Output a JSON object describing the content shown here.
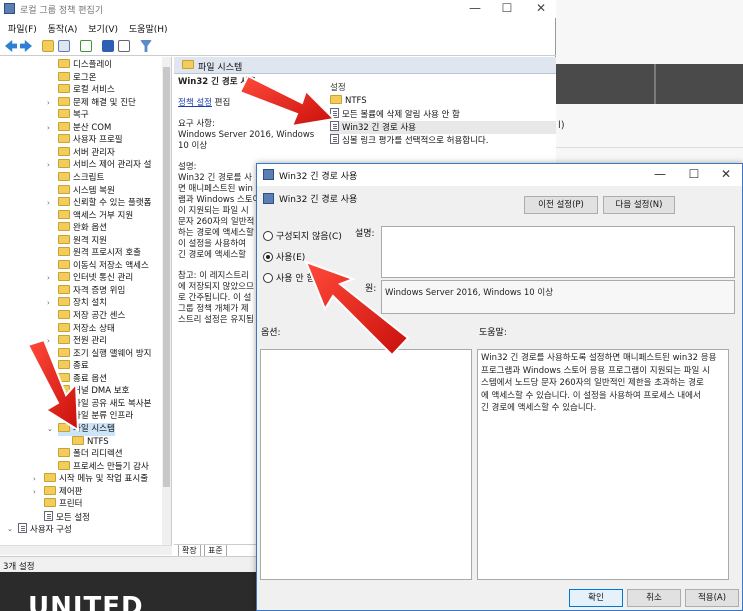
{
  "main_window": {
    "title": "로컬 그룹 정책 편집기",
    "controls": {
      "minimize": "—",
      "maximize": "☐",
      "close": "✕"
    },
    "menu": [
      "파일(F)",
      "동작(A)",
      "보기(V)",
      "도움말(H)"
    ],
    "toolbar_icons": [
      "back-icon",
      "forward-icon",
      "folder-up-icon",
      "show-hide-tree-icon",
      "export-icon",
      "help-icon",
      "properties-icon",
      "filter-icon"
    ]
  },
  "tree": {
    "items": [
      {
        "label": "디스플레이",
        "expand": ""
      },
      {
        "label": "로그온",
        "expand": ""
      },
      {
        "label": "로컬 서비스",
        "expand": ""
      },
      {
        "label": "문제 해결 및 진단",
        "expand": "›"
      },
      {
        "label": "복구",
        "expand": ""
      },
      {
        "label": "분산 COM",
        "expand": "›"
      },
      {
        "label": "사용자 프로필",
        "expand": ""
      },
      {
        "label": "서버 관리자",
        "expand": ""
      },
      {
        "label": "서비스 제어 관리자 설",
        "expand": "›"
      },
      {
        "label": "스크립트",
        "expand": ""
      },
      {
        "label": "시스템 복원",
        "expand": ""
      },
      {
        "label": "신뢰할 수 있는 플랫폼",
        "expand": "›"
      },
      {
        "label": "액세스 거부 지원",
        "expand": ""
      },
      {
        "label": "완화 옵션",
        "expand": ""
      },
      {
        "label": "원격 지원",
        "expand": ""
      },
      {
        "label": "원격 프로시저 호출",
        "expand": ""
      },
      {
        "label": "이동식 저장소 액세스",
        "expand": ""
      },
      {
        "label": "인터넷 통신 관리",
        "expand": "›"
      },
      {
        "label": "자격 증명 위임",
        "expand": ""
      },
      {
        "label": "장치 설치",
        "expand": "›"
      },
      {
        "label": "저장 공간 센스",
        "expand": ""
      },
      {
        "label": "저장소 상태",
        "expand": ""
      },
      {
        "label": "전원 관리",
        "expand": "›"
      },
      {
        "label": "조기 실행 맬웨어 방지",
        "expand": ""
      },
      {
        "label": "종료",
        "expand": ""
      },
      {
        "label": "종료 옵션",
        "expand": ""
      },
      {
        "label": "커널 DMA 보호",
        "expand": ""
      },
      {
        "label": "파일 공유 새도 복사본",
        "expand": ""
      },
      {
        "label": "파일 분류 인프라",
        "expand": ""
      },
      {
        "label": "파일 시스템",
        "expand": "⌄"
      },
      {
        "label": "NTFS",
        "expand": ""
      },
      {
        "label": "폴더 리디렉션",
        "expand": ""
      },
      {
        "label": "프로세스 만들기 감사",
        "expand": ""
      },
      {
        "label": "시작 메뉴 및 작업 표시줄",
        "expand": "›"
      },
      {
        "label": "제어판",
        "expand": "›"
      },
      {
        "label": "프린터",
        "expand": ""
      },
      {
        "label": "모든 설정",
        "expand": ""
      },
      {
        "label": "사용자 구성",
        "expand": "⌄"
      }
    ]
  },
  "status_bar": {
    "text": "3개 설정"
  },
  "right_pane": {
    "header": "파일 시스템",
    "policy_title": "Win32 긴 경로 사용",
    "edit_link": "정책 설정",
    "edit_suffix": " 편집",
    "requirements_label": "요구 사항:",
    "requirements": "Windows Server 2016, Windows 10 이상",
    "description_label": "설명:",
    "description_lines": [
      "Win32 긴 경로를 사",
      "면 매니페스트된 win",
      "램과 Windows 스토어",
      "이 지원되는 파일 시",
      "문자 260자의 일반적",
      "하는 경로에 액세스할",
      "이 설정을 사용하여",
      "긴 경로에 액세스할"
    ],
    "note_lines": [
      "참고: 이 레지스트리",
      "에 저장되지 않았으므",
      "로 간주됩니다.  이 설",
      "그룹 정책 개체가 제",
      "스트리 설정은 유지됩"
    ],
    "list_header": "설정",
    "list": [
      {
        "label": "NTFS",
        "icon": "folder-icon"
      },
      {
        "label": "모든 볼륨에 삭제 알림 사용 안 함",
        "icon": "policy-icon"
      },
      {
        "label": "Win32 긴 경로 사용",
        "icon": "policy-icon"
      },
      {
        "label": "심볼 링크 평가를 선택적으로 허용합니다.",
        "icon": "policy-icon"
      }
    ],
    "tabs": [
      "확장",
      "표준"
    ]
  },
  "dialog": {
    "title": "Win32 긴 경로 사용",
    "subtitle": "Win32 긴 경로 사용",
    "controls": {
      "minimize": "—",
      "maximize": "☐",
      "close": "✕"
    },
    "prev_button": "이전 설정(P)",
    "next_button": "다음 설정(N)",
    "options": [
      {
        "label": "구성되지 않음(C)",
        "checked": false
      },
      {
        "label": "사용(E)",
        "checked": true
      },
      {
        "label": "사용 안 함",
        "checked": false
      }
    ],
    "comment_label": "설명:",
    "supported_label": "원:",
    "supported_value": "Windows Server 2016, Windows 10 이상",
    "options_label": "옵션:",
    "help_label": "도움말:",
    "help_lines": [
      "Win32 긴 경로를 사용하도록 설정하면 매니페스트된 win32 응용",
      "프로그램과 Windows 스토어 응용 프로그램이 지원되는 파일 시",
      "스템에서 노드당 문자 260자의 일반적인 제한을 초과하는 경로",
      "에 액세스할 수 있습니다. 이 설정을 사용하여 프로세스 내에서",
      "긴 경로에 액세스할 수 있습니다."
    ],
    "ok_button": "확인",
    "cancel_button": "취소",
    "apply_button": "적용(A)"
  },
  "background": {
    "behind_text": "l)",
    "bottom_text": "UNITED"
  },
  "colors": {
    "accent": "#0078d7",
    "arrow_red": "#e8201c",
    "folder": "#f3cd5c"
  }
}
